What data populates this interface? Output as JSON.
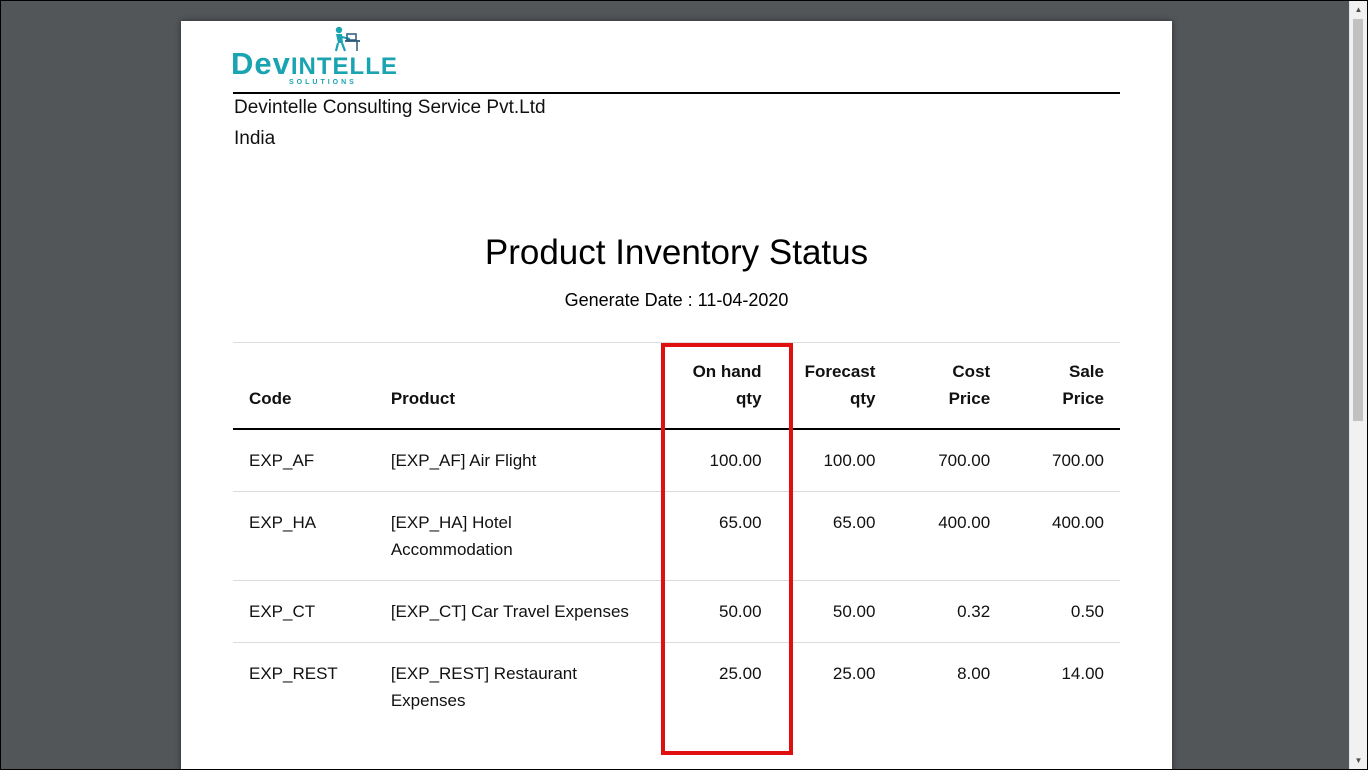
{
  "logo": {
    "text_part1": "Dev",
    "text_part2": "Intelle",
    "subtitle": "SOLUTIONS",
    "brand_color": "#1aa3b1"
  },
  "company": {
    "name": "Devintelle Consulting Service Pvt.Ltd",
    "country": "India"
  },
  "report": {
    "title": "Product Inventory Status",
    "generate_date": "Generate Date : 11-04-2020"
  },
  "table": {
    "headers": {
      "code": "Code",
      "product": "Product",
      "onhand_1": "On hand",
      "onhand_2": "qty",
      "forecast_1": "Forecast",
      "forecast_2": "qty",
      "cost_1": "Cost",
      "cost_2": "Price",
      "sale_1": "Sale",
      "sale_2": "Price"
    },
    "rows": [
      {
        "code": "EXP_AF",
        "product": "[EXP_AF] Air Flight",
        "onhand": "100.00",
        "forecast": "100.00",
        "cost": "700.00",
        "sale": "700.00"
      },
      {
        "code": "EXP_HA",
        "product": "[EXP_HA] Hotel Accommodation",
        "onhand": "65.00",
        "forecast": "65.00",
        "cost": "400.00",
        "sale": "400.00"
      },
      {
        "code": "EXP_CT",
        "product": "[EXP_CT] Car Travel Expenses",
        "onhand": "50.00",
        "forecast": "50.00",
        "cost": "0.32",
        "sale": "0.50"
      },
      {
        "code": "EXP_REST",
        "product": "[EXP_REST] Restaurant Expenses",
        "onhand": "25.00",
        "forecast": "25.00",
        "cost": "8.00",
        "sale": "14.00"
      }
    ]
  },
  "colors": {
    "highlight": "#e01010",
    "viewer_background": "#525659"
  }
}
